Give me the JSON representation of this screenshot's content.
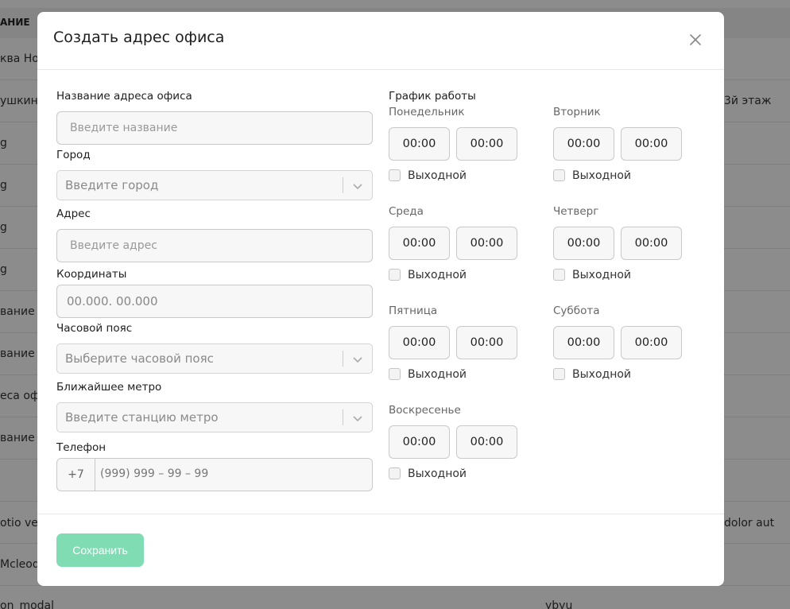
{
  "background": {
    "header_fragment": "АНИЕ",
    "rows": [
      {
        "left": "ква Нов",
        "right": ""
      },
      {
        "left": "ушкинск",
        "right": "3й этаж"
      },
      {
        "left": "g",
        "right": ""
      },
      {
        "left": "g",
        "right": ""
      },
      {
        "left": "g",
        "right": ""
      },
      {
        "left": "g",
        "right": ""
      },
      {
        "left": "вание а",
        "right": ""
      },
      {
        "left": "вание а",
        "right": ""
      },
      {
        "left": "еса офи",
        "right": ""
      },
      {
        "left": "вание а",
        "right": ""
      },
      {
        "left": "",
        "right": ""
      },
      {
        "left": "otio vera",
        "right": "dolor aut"
      },
      {
        "left": "Mcleod",
        "right": ""
      },
      {
        "left": "on_modal",
        "right": "ybyu"
      }
    ]
  },
  "modal": {
    "title": "Создать адрес офиса",
    "fields": {
      "office_name": {
        "label": "Название адреса офиса",
        "placeholder": "Введите название"
      },
      "city": {
        "label": "Город",
        "placeholder": "Введите город"
      },
      "address": {
        "label": "Адрес",
        "placeholder": "Введите адрес"
      },
      "coordinates": {
        "label": "Координаты",
        "placeholder": "00.000. 00.000"
      },
      "timezone": {
        "label": "Часовой пояс",
        "placeholder": "Выберите часовой пояс"
      },
      "metro": {
        "label": "Ближайшее метро",
        "placeholder": "Введите станцию метро"
      },
      "phone": {
        "label": "Телефон",
        "code": "+7",
        "placeholder": "(999) 999 – 99 – 99"
      }
    },
    "schedule": {
      "title": "График работы",
      "dayoff_label": "Выходной",
      "days": [
        {
          "name": "Понедельник",
          "from": "00:00",
          "to": "00:00"
        },
        {
          "name": "Вторник",
          "from": "00:00",
          "to": "00:00"
        },
        {
          "name": "Среда",
          "from": "00:00",
          "to": "00:00"
        },
        {
          "name": "Четверг",
          "from": "00:00",
          "to": "00:00"
        },
        {
          "name": "Пятница",
          "from": "00:00",
          "to": "00:00"
        },
        {
          "name": "Суббота",
          "from": "00:00",
          "to": "00:00"
        },
        {
          "name": "Воскресенье",
          "from": "00:00",
          "to": "00:00"
        }
      ]
    },
    "save_label": "Сохранить"
  },
  "colors": {
    "save_button": "#7fdcb3",
    "overlay": "rgba(0,0,0,0.45)"
  },
  "icons": {
    "close": "close-icon",
    "chevron": "chevron-down-icon"
  }
}
